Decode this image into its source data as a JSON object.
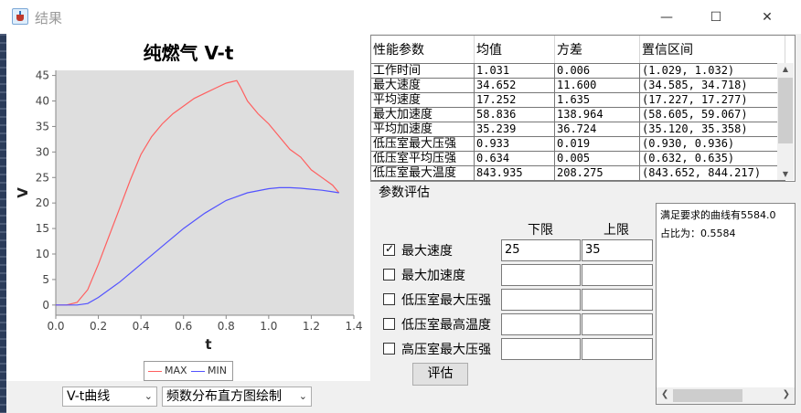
{
  "window": {
    "title": "结果",
    "minimize": "—",
    "maximize": "☐",
    "close": "✕"
  },
  "chart_data": {
    "type": "line",
    "title": "纯燃气 V-t",
    "xlabel": "t",
    "ylabel": "V",
    "xlim": [
      0,
      1.4
    ],
    "ylim": [
      -2,
      46
    ],
    "xticks": [
      "0.0",
      "0.2",
      "0.4",
      "0.6",
      "0.8",
      "1.0",
      "1.2",
      "1.4"
    ],
    "yticks": [
      "0",
      "5",
      "10",
      "15",
      "20",
      "25",
      "30",
      "35",
      "40",
      "45"
    ],
    "grid": false,
    "legend_position": "bottom",
    "series": [
      {
        "name": "MAX",
        "color": "#ff5f5f",
        "x": [
          0,
          0.05,
          0.1,
          0.15,
          0.2,
          0.25,
          0.3,
          0.35,
          0.4,
          0.45,
          0.5,
          0.55,
          0.6,
          0.65,
          0.7,
          0.75,
          0.8,
          0.85,
          0.87,
          0.9,
          0.95,
          1.0,
          1.05,
          1.1,
          1.15,
          1.2,
          1.25,
          1.3,
          1.33
        ],
        "y": [
          0,
          0,
          0.5,
          3,
          8,
          13.5,
          19,
          24.5,
          29.5,
          33,
          35.5,
          37.5,
          39,
          40.5,
          41.5,
          42.5,
          43.5,
          44,
          42.5,
          40,
          37.5,
          35.5,
          33,
          30.5,
          29,
          26.5,
          25,
          23.5,
          22
        ]
      },
      {
        "name": "MIN",
        "color": "#5353ff",
        "x": [
          0,
          0.1,
          0.15,
          0.2,
          0.3,
          0.4,
          0.5,
          0.6,
          0.7,
          0.8,
          0.9,
          1.0,
          1.05,
          1.1,
          1.15,
          1.2,
          1.25,
          1.3,
          1.33
        ],
        "y": [
          0,
          0,
          0.3,
          1.5,
          4.5,
          8,
          11.5,
          15,
          18,
          20.5,
          22,
          22.8,
          23,
          23,
          22.9,
          22.7,
          22.5,
          22.2,
          22
        ]
      }
    ]
  },
  "controls": {
    "curve_combo": "V-t曲线",
    "hist_combo": "频数分布直方图绘制"
  },
  "table": {
    "headers": [
      "性能参数",
      "均值",
      "方差",
      "置信区间"
    ],
    "rows": [
      [
        "工作时间",
        "1.031",
        "0.006",
        "(1.029, 1.032)"
      ],
      [
        "最大速度",
        "34.652",
        "11.600",
        "(34.585, 34.718)"
      ],
      [
        "平均速度",
        "17.252",
        "1.635",
        "(17.227, 17.277)"
      ],
      [
        "最大加速度",
        "58.836",
        "138.964",
        "(58.605, 59.067)"
      ],
      [
        "平均加速度",
        "35.239",
        "36.724",
        "(35.120, 35.358)"
      ],
      [
        "低压室最大压强",
        "0.933",
        "0.019",
        "(0.930, 0.936)"
      ],
      [
        "低压室平均压强",
        "0.634",
        "0.005",
        "(0.632, 0.635)"
      ],
      [
        "低压室最大温度",
        "843.935",
        "208.275",
        "(843.652, 844.217)"
      ]
    ]
  },
  "eval": {
    "group_title": "参数评估",
    "lower_label": "下限",
    "upper_label": "上限",
    "rows": [
      {
        "label": "最大速度",
        "checked": true,
        "lower": "25",
        "upper": "35"
      },
      {
        "label": "最大加速度",
        "checked": false,
        "lower": "",
        "upper": ""
      },
      {
        "label": "低压室最大压强",
        "checked": false,
        "lower": "",
        "upper": ""
      },
      {
        "label": "低压室最高温度",
        "checked": false,
        "lower": "",
        "upper": ""
      },
      {
        "label": "高压室最大压强",
        "checked": false,
        "lower": "",
        "upper": ""
      }
    ],
    "button": "评估"
  },
  "result": {
    "line1": "满足要求的曲线有5584.0",
    "line2": "占比为：0.5584"
  }
}
